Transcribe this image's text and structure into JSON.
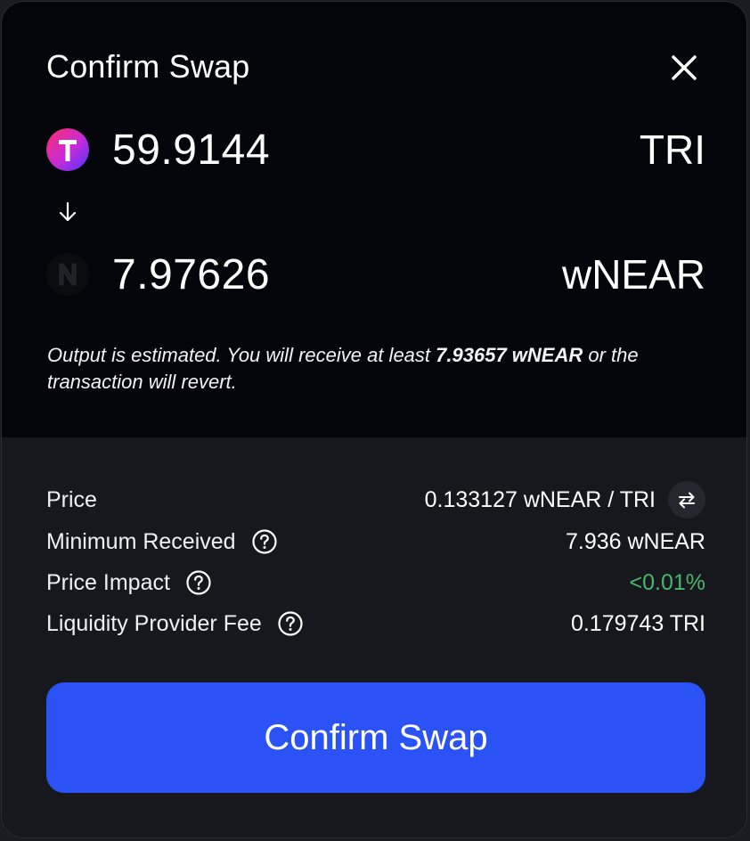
{
  "modal": {
    "title": "Confirm Swap",
    "close_icon": "close-icon"
  },
  "from": {
    "amount": "59.9144",
    "symbol": "TRI",
    "icon": "tri-token-icon",
    "icon_letter": "T"
  },
  "to": {
    "amount": "7.97626",
    "symbol": "wNEAR",
    "icon": "wnear-token-icon",
    "icon_letter": "N"
  },
  "note": {
    "prefix": "Output is estimated. You will receive at least ",
    "min_amount": "7.93657 wNEAR",
    "suffix": " or the transaction will revert."
  },
  "details": {
    "price_label": "Price",
    "price_value": "0.133127 wNEAR / TRI",
    "min_received_label": "Minimum Received",
    "min_received_value": "7.936 wNEAR",
    "price_impact_label": "Price Impact",
    "price_impact_value": "<0.01%",
    "lp_fee_label": "Liquidity Provider Fee",
    "lp_fee_value": "0.179743 TRI"
  },
  "actions": {
    "confirm_label": "Confirm Swap"
  },
  "colors": {
    "accent": "#2a52f5",
    "positive": "#49b66b",
    "panel_top": "#03050a",
    "panel_bottom": "#16181d"
  }
}
